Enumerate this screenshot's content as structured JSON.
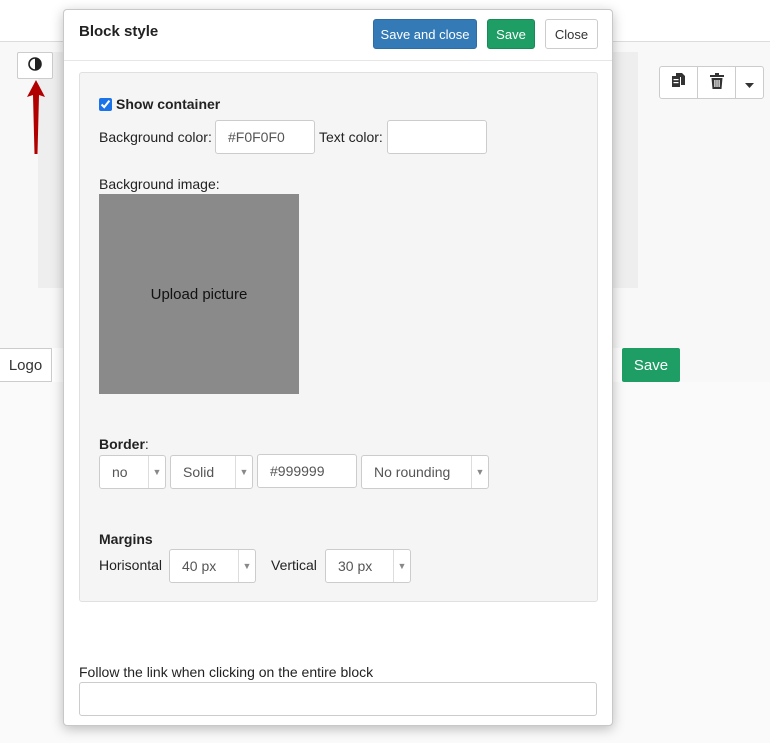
{
  "background": {
    "contrast_icon": "half-circle-icon",
    "copy_icon": "copy-icon",
    "trash_icon": "trash-icon",
    "dropdown_icon": "caret-down-icon",
    "logo_tab": "Logo",
    "save_label": "Save"
  },
  "modal": {
    "title": "Block style",
    "buttons": {
      "save_close": "Save and close",
      "save": "Save",
      "close": "Close"
    },
    "show_container": {
      "label": "Show container",
      "checked": true
    },
    "background_color": {
      "label": "Background color:",
      "value": "#F0F0F0"
    },
    "text_color": {
      "label": "Text color:",
      "value": ""
    },
    "background_image": {
      "label": "Background image:",
      "upload_label": "Upload picture"
    },
    "border": {
      "label": "Border",
      "suffix": ":",
      "width": "no",
      "style": "Solid",
      "color": "#999999",
      "rounding": "No rounding"
    },
    "margins": {
      "label": "Margins",
      "horizontal_label": "Horisontal",
      "horizontal_value": "40 px",
      "vertical_label": "Vertical",
      "vertical_value": "30 px"
    },
    "link": {
      "label": "Follow the link when clicking on the entire block",
      "value": ""
    }
  },
  "colors": {
    "primary": "#337ab7",
    "success": "#1e9e64",
    "arrow": "#b00000",
    "upload_bg": "#8a8a8a"
  }
}
